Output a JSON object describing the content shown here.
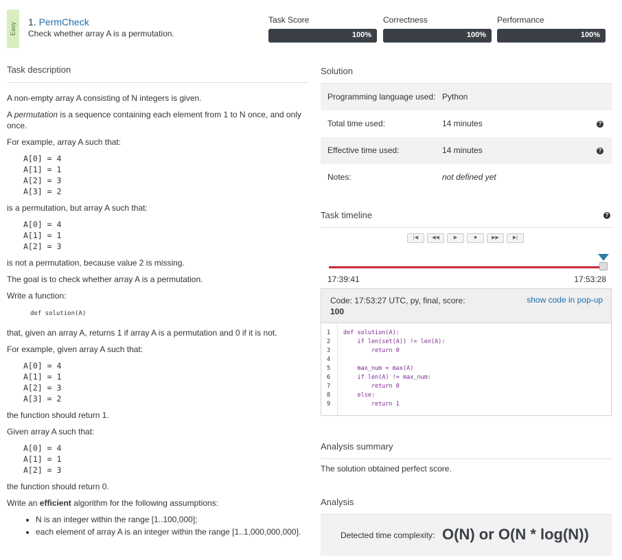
{
  "header": {
    "difficulty": "Easy",
    "task_number": "1.",
    "task_name": "PermCheck",
    "task_subtitle": "Check whether array A is a permutation."
  },
  "metrics": [
    {
      "label": "Task Score",
      "value": "100%",
      "fraction": 1.0
    },
    {
      "label": "Correctness",
      "value": "100%",
      "fraction": 1.0
    },
    {
      "label": "Performance",
      "value": "100%",
      "fraction": 1.0
    }
  ],
  "description": {
    "title": "Task description",
    "p1": "A non-empty array A consisting of N integers is given.",
    "p2_pre": "A ",
    "p2_em": "permutation",
    "p2_post": " is a sequence containing each element from 1 to N once, and only once.",
    "p3": "For example, array A such that:",
    "ex1": [
      "A[0] = 4",
      "A[1] = 1",
      "A[2] = 3",
      "A[3] = 2"
    ],
    "p4": "is a permutation, but array A such that:",
    "ex2": [
      "A[0] = 4",
      "A[1] = 1",
      "A[2] = 3"
    ],
    "p5": "is not a permutation, because value 2 is missing.",
    "p6": "The goal is to check whether array A is a permutation.",
    "p7": "Write a function:",
    "signature": "def solution(A)",
    "p8": "that, given an array A, returns 1 if array A is a permutation and 0 if it is not.",
    "p9": "For example, given array A such that:",
    "ex3": [
      "A[0] = 4",
      "A[1] = 1",
      "A[2] = 3",
      "A[3] = 2"
    ],
    "p10": "the function should return 1.",
    "p11": "Given array A such that:",
    "ex4": [
      "A[0] = 4",
      "A[1] = 1",
      "A[2] = 3"
    ],
    "p12": "the function should return 0.",
    "p13_pre": "Write an ",
    "p13_strong": "efficient",
    "p13_post": " algorithm for the following assumptions:",
    "assumptions": [
      "N is an integer within the range [1..100,000];",
      "each element of array A is an integer within the range [1..1,000,000,000]."
    ]
  },
  "solution": {
    "title": "Solution",
    "rows": [
      {
        "key": "Programming language used:",
        "value": "Python"
      },
      {
        "key": "Total time used:",
        "value": "14 minutes"
      },
      {
        "key": "Effective time used:",
        "value": "14 minutes"
      },
      {
        "key": "Notes:",
        "value": "not defined yet"
      }
    ]
  },
  "timeline": {
    "title": "Task timeline",
    "controls": [
      "|◀",
      "◀◀",
      "▶",
      "■",
      "▶▶",
      "▶|"
    ],
    "start": "17:39:41",
    "end": "17:53:28"
  },
  "code": {
    "info_line": "Code: 17:53:27 UTC, py, final, score:",
    "score": "100",
    "popup_label": "show code in pop-up",
    "lines": [
      {
        "n": "1",
        "src": "def solution(A):"
      },
      {
        "n": "2",
        "src": "    if len(set(A)) != len(A):"
      },
      {
        "n": "3",
        "src": "        return 0"
      },
      {
        "n": "4",
        "src": ""
      },
      {
        "n": "5",
        "src": "    max_num = max(A)"
      },
      {
        "n": "6",
        "src": "    if len(A) != max_num:"
      },
      {
        "n": "7",
        "src": "        return 0"
      },
      {
        "n": "8",
        "src": "    else:"
      },
      {
        "n": "9",
        "src": "        return 1"
      }
    ]
  },
  "analysis_summary": {
    "title": "Analysis summary",
    "text": "The solution obtained perfect score."
  },
  "analysis": {
    "title": "Analysis",
    "key": "Detected time complexity:",
    "value": "O(N) or O(N * log(N))"
  }
}
